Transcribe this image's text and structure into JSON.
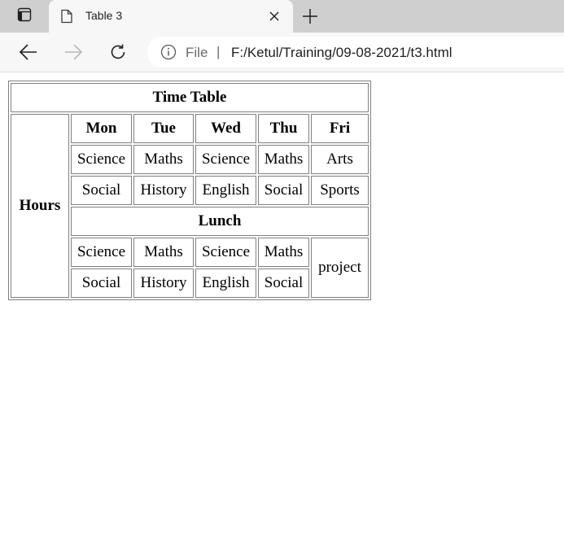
{
  "browser": {
    "tab_title": "Table 3",
    "address_scheme_label": "File",
    "address_separator": "|",
    "address_url": "F:/Ketul/Training/09-08-2021/t3.html"
  },
  "timetable": {
    "title": "Time Table",
    "row_header": "Hours",
    "days": [
      "Mon",
      "Tue",
      "Wed",
      "Thu",
      "Fri"
    ],
    "morning": [
      [
        "Science",
        "Maths",
        "Science",
        "Maths",
        "Arts"
      ],
      [
        "Social",
        "History",
        "English",
        "Social",
        "Sports"
      ]
    ],
    "break_label": "Lunch",
    "afternoon": [
      [
        "Science",
        "Maths",
        "Science",
        "Maths"
      ],
      [
        "Social",
        "History",
        "English",
        "Social"
      ]
    ],
    "afternoon_friday": "project"
  }
}
